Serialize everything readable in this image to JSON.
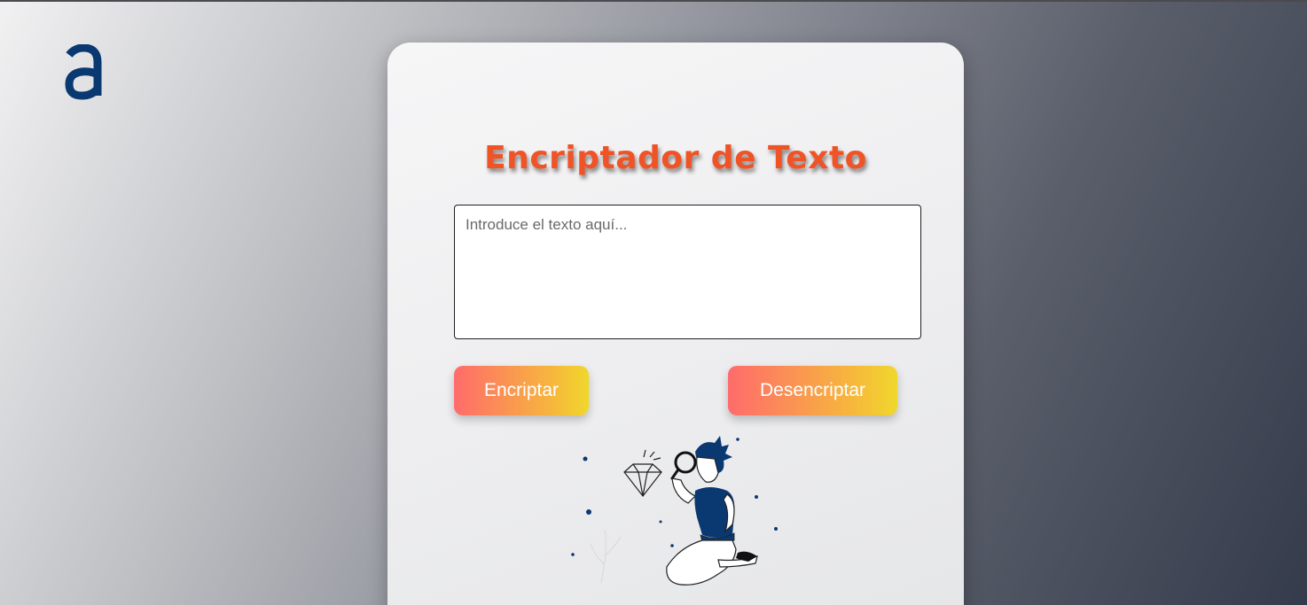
{
  "logo": {
    "glyph": "a",
    "color": "#0a3871"
  },
  "card": {
    "title": "Encriptador de Texto",
    "input": {
      "placeholder": "Introduce el texto aquí...",
      "value": ""
    },
    "buttons": {
      "encrypt_label": "Encriptar",
      "decrypt_label": "Desencriptar"
    },
    "illustration": {
      "icon": "person-inspecting-diamond-illustration"
    }
  },
  "colors": {
    "title": "#f05326",
    "brand_navy": "#0a3871",
    "button_gradient_start": "#ff6b6b",
    "button_gradient_end": "#f0d72c"
  }
}
